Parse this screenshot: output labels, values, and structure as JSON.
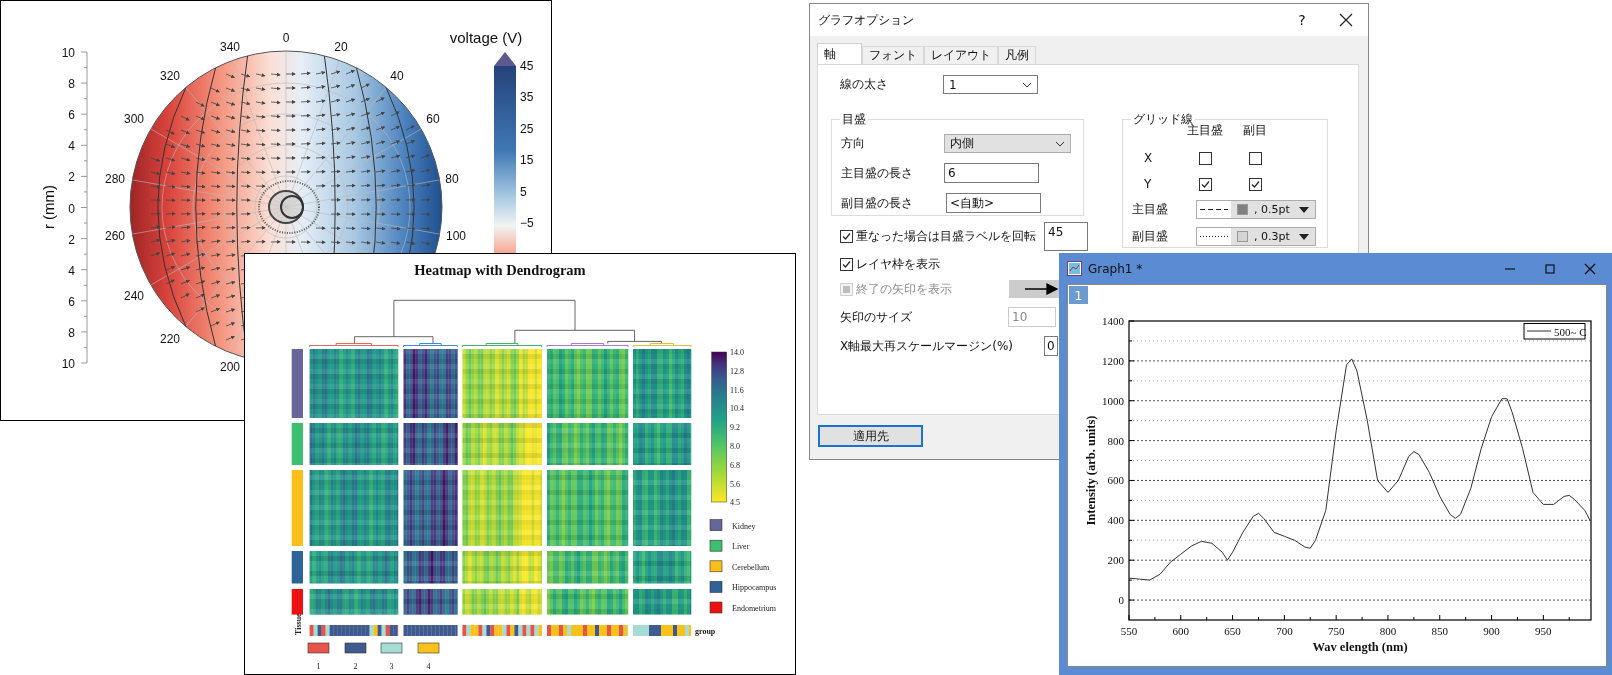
{
  "polar_plot": {
    "r_axis": {
      "title": "r (mm)",
      "ticks": [
        "10",
        "8",
        "6",
        "4",
        "2",
        "0",
        "2",
        "4",
        "6",
        "8",
        "10"
      ]
    },
    "angle_labels": [
      "0",
      "20",
      "40",
      "60",
      "80",
      "100",
      "200",
      "220",
      "240",
      "260",
      "280",
      "300",
      "320",
      "340"
    ],
    "colorbar": {
      "title": "voltage (V)",
      "ticks": [
        "45",
        "35",
        "25",
        "15",
        "5",
        "−5"
      ]
    }
  },
  "heatmap": {
    "title": "Heatmap with Dendrogram",
    "colorbar_ticks": [
      "14.0",
      "12.8",
      "11.6",
      "10.4",
      "9.2",
      "8.0",
      "6.8",
      "5.6",
      "4.5"
    ],
    "tissues": [
      {
        "name": "Kidney",
        "color": "#66669a"
      },
      {
        "name": "Liver",
        "color": "#3cbf6e"
      },
      {
        "name": "Cerebellum",
        "color": "#fbbf1a"
      },
      {
        "name": "Hippocampus",
        "color": "#2f6296"
      },
      {
        "name": "Endometrium",
        "color": "#ee1111"
      }
    ],
    "tissue_axis_label": "Tissue",
    "group_label": "group",
    "groups": [
      {
        "label": "1",
        "color": "#e8534a"
      },
      {
        "label": "2",
        "color": "#3f5a8f"
      },
      {
        "label": "3",
        "color": "#a6dcd3"
      },
      {
        "label": "4",
        "color": "#f8c21b"
      }
    ]
  },
  "dialog": {
    "title": "グラフオプション",
    "help": "?",
    "tabs": [
      {
        "label": "軸",
        "selected": true
      },
      {
        "label": "フォント",
        "selected": false
      },
      {
        "label": "レイアウト",
        "selected": false
      },
      {
        "label": "凡例",
        "selected": false
      }
    ],
    "line_width": {
      "label": "線の太さ",
      "value": "1"
    },
    "ticks_group": {
      "title": "目盛",
      "direction": {
        "label": "方向",
        "value": "内側"
      },
      "major_length": {
        "label": "主目盛の長さ",
        "value": "6"
      },
      "minor_length": {
        "label": "副目盛の長さ",
        "value": "<自動>"
      }
    },
    "rotate_labels": {
      "label": "重なった場合は目盛ラベルを回転",
      "checked": true,
      "value": "45"
    },
    "show_frame": {
      "label": "レイヤ枠を表示",
      "checked": true
    },
    "end_arrow": {
      "label": "終了の矢印を表示",
      "checked": false,
      "disabled": true
    },
    "arrow_size": {
      "label": "矢印のサイズ",
      "value": "10",
      "disabled": true
    },
    "rescale_margin": {
      "label": "X軸最大再スケールマージン(%)",
      "value": "0"
    },
    "grid": {
      "title": "グリッド線",
      "columns": [
        "主目盛",
        "副目"
      ],
      "rows": [
        {
          "axis": "X",
          "major": false,
          "minor": false
        },
        {
          "axis": "Y",
          "major": true,
          "minor": true
        }
      ],
      "styles": [
        {
          "label": "主目盛",
          "kind": "dashed",
          "color": "#808080",
          "width": ", 0.5pt"
        },
        {
          "label": "副目盛",
          "kind": "dotted",
          "color": "#d4d4d4",
          "width": ", 0.3pt"
        }
      ]
    },
    "apply_button": "適用先"
  },
  "graph_window": {
    "title": "Graph1 *",
    "layer": "1",
    "chart_data": {
      "type": "line",
      "xlabel": "Wav elength (nm)",
      "ylabel": "Intensity (arb. units)",
      "x": [
        550,
        560,
        570,
        580,
        590,
        600,
        610,
        620,
        630,
        640,
        645,
        650,
        660,
        670,
        675,
        680,
        690,
        700,
        710,
        720,
        725,
        730,
        740,
        750,
        760,
        765,
        770,
        780,
        790,
        800,
        810,
        820,
        825,
        830,
        840,
        850,
        860,
        865,
        870,
        880,
        890,
        900,
        910,
        915,
        920,
        930,
        940,
        950,
        960,
        970,
        975,
        980,
        990,
        995
      ],
      "series": [
        {
          "name": "500~ C",
          "color": "#333333",
          "values": [
            110,
            105,
            100,
            130,
            190,
            230,
            270,
            295,
            285,
            240,
            200,
            240,
            340,
            420,
            435,
            410,
            340,
            320,
            300,
            265,
            260,
            300,
            450,
            850,
            1180,
            1210,
            1150,
            900,
            600,
            540,
            600,
            720,
            745,
            730,
            640,
            520,
            430,
            410,
            430,
            560,
            760,
            920,
            1010,
            1010,
            940,
            760,
            540,
            480,
            480,
            520,
            525,
            505,
            450,
            400
          ]
        }
      ],
      "xlim": [
        550,
        996
      ],
      "ylim": [
        -100,
        1400
      ],
      "xticks": [
        550,
        600,
        650,
        700,
        750,
        800,
        850,
        900,
        950
      ],
      "yticks": [
        0,
        200,
        400,
        600,
        800,
        1000,
        1200,
        1400
      ],
      "grid": true
    }
  }
}
